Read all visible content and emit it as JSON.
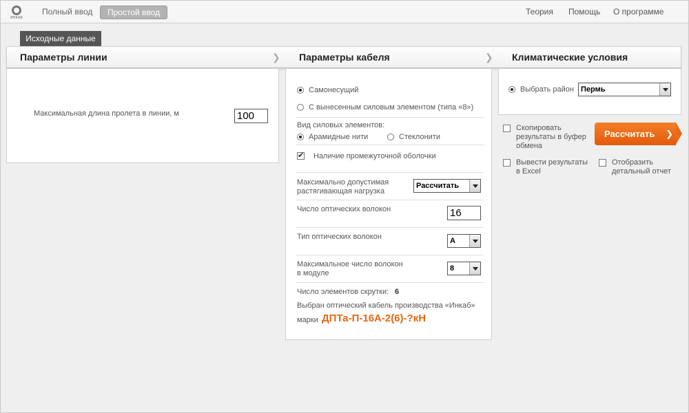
{
  "topbar": {
    "logo_text": "ИНКАБ",
    "mode_full": "Полный ввод",
    "mode_simple": "Простой ввод",
    "links": [
      "Теория",
      "Помощь",
      "О программе"
    ]
  },
  "tab_source": "Исходные данные",
  "sections": {
    "line": "Параметры линии",
    "cable": "Параметры кабеля",
    "climate": "Климатические условия"
  },
  "line": {
    "max_span_label": "Максимальная длина пролета в линии, м",
    "max_span_value": "100"
  },
  "cable": {
    "radio_self_supporting": "Самонесущий",
    "radio_external_element": "С вынесенным силовым элементом (типа «8»)",
    "power_elements_label": "Вид силовых элементов:",
    "radio_aramid": "Арамидные нити",
    "radio_fiberglass": "Стеклонити",
    "intermediate_sheath": "Наличие промежуточной оболочки",
    "max_load_label_1": "Максимально допустимая",
    "max_load_label_2": "растягивающая нагрузка",
    "max_load_value": "Рассчитать",
    "fiber_count_label": "Число оптических волокон",
    "fiber_count_value": "16",
    "fiber_type_label": "Тип оптических волокон",
    "fiber_type_value": "A",
    "max_in_module_label_1": "Максимальное число волокон",
    "max_in_module_label_2": "в модуле",
    "max_in_module_value": "8",
    "twist_elements_label": "Число элементов скрутки:",
    "twist_elements_value": "6",
    "selected_text_1": "Выбран оптический кабель производства «Инкаб»",
    "selected_text_2": "марки",
    "cable_mark": "ДПТа-П-16А-2(6)-?кН"
  },
  "climate": {
    "region_label": "Выбрать район",
    "region_value": "Пермь"
  },
  "options": {
    "copy_clipboard_1": "Скопировать",
    "copy_clipboard_2": "результаты в буфер",
    "copy_clipboard_3": "обмена",
    "export_excel_1": "Вывести результаты",
    "export_excel_2": "в Excel",
    "detailed_report_1": "Отобразить",
    "detailed_report_2": "детальный отчет",
    "calculate": "Рассчитать"
  },
  "colors": {
    "accent": "#e8650f",
    "tab_dark": "#555555"
  }
}
